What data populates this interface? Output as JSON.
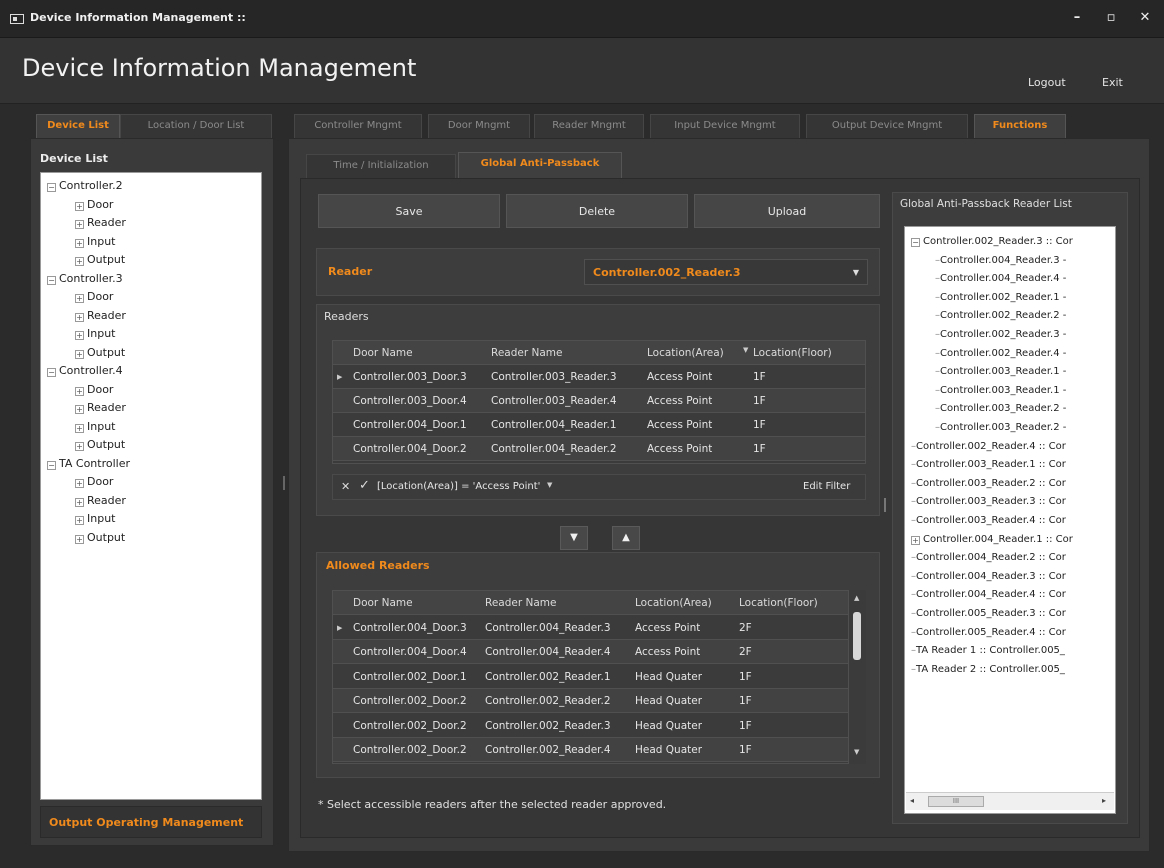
{
  "window": {
    "title": "Device Information Management ::",
    "controls": [
      "minimize-icon",
      "maximize-icon",
      "close-icon"
    ]
  },
  "header": {
    "title": "Device Information Management",
    "logout": "Logout",
    "exit": "Exit"
  },
  "left": {
    "tabs": [
      "Device List",
      "Location / Door List"
    ],
    "list_title": "Device List",
    "tree": [
      {
        "label": "Controller.2",
        "children": [
          "Door",
          "Reader",
          "Input",
          "Output"
        ]
      },
      {
        "label": "Controller.3",
        "children": [
          "Door",
          "Reader",
          "Input",
          "Output"
        ]
      },
      {
        "label": "Controller.4",
        "children": [
          "Door",
          "Reader",
          "Input",
          "Output"
        ]
      },
      {
        "label": "TA Controller",
        "children": [
          "Door",
          "Reader",
          "Input",
          "Output"
        ]
      }
    ],
    "bottom_button": "Output Operating Management"
  },
  "main_tabs": [
    "Controller Mngmt",
    "Door Mngmt",
    "Reader Mngmt",
    "Input Device Mngmt",
    "Output Device Mngmt",
    "Functions"
  ],
  "sub_tabs": [
    "Time / Initialization",
    "Global Anti-Passback"
  ],
  "actions": {
    "save": "Save",
    "delete": "Delete",
    "upload": "Upload"
  },
  "reader": {
    "label": "Reader",
    "value": "Controller.002_Reader.3"
  },
  "readers": {
    "title": "Readers",
    "columns": [
      "Door Name",
      "Reader Name",
      "Location(Area)",
      "Location(Floor)"
    ],
    "rows": [
      [
        "Controller.003_Door.3",
        "Controller.003_Reader.3",
        "Access Point",
        "1F"
      ],
      [
        "Controller.003_Door.4",
        "Controller.003_Reader.4",
        "Access Point",
        "1F"
      ],
      [
        "Controller.004_Door.1",
        "Controller.004_Reader.1",
        "Access Point",
        "1F"
      ],
      [
        "Controller.004_Door.2",
        "Controller.004_Reader.2",
        "Access Point",
        "1F"
      ]
    ],
    "filter_text": "[Location(Area)] = 'Access Point'",
    "edit_filter": "Edit Filter"
  },
  "allowed": {
    "title": "Allowed Readers",
    "columns": [
      "Door Name",
      "Reader Name",
      "Location(Area)",
      "Location(Floor)"
    ],
    "rows": [
      [
        "Controller.004_Door.3",
        "Controller.004_Reader.3",
        "Access Point",
        "2F"
      ],
      [
        "Controller.004_Door.4",
        "Controller.004_Reader.4",
        "Access Point",
        "2F"
      ],
      [
        "Controller.002_Door.1",
        "Controller.002_Reader.1",
        "Head Quater",
        "1F"
      ],
      [
        "Controller.002_Door.2",
        "Controller.002_Reader.2",
        "Head Quater",
        "1F"
      ],
      [
        "Controller.002_Door.2",
        "Controller.002_Reader.3",
        "Head Quater",
        "1F"
      ],
      [
        "Controller.002_Door.2",
        "Controller.002_Reader.4",
        "Head Quater",
        "1F"
      ]
    ]
  },
  "note": "* Select accessible readers after the selected reader approved.",
  "gapb": {
    "title": "Global Anti-Passback Reader List",
    "root": "Controller.002_Reader.3 :: Cor",
    "children": [
      "Controller.004_Reader.3 -",
      "Controller.004_Reader.4 -",
      "Controller.002_Reader.1 -",
      "Controller.002_Reader.2 -",
      "Controller.002_Reader.3 -",
      "Controller.002_Reader.4 -",
      "Controller.003_Reader.1 -",
      "Controller.003_Reader.1 -",
      "Controller.003_Reader.2 -",
      "Controller.003_Reader.2 -"
    ],
    "items": [
      "Controller.002_Reader.4 :: Cor",
      "Controller.003_Reader.1 :: Cor",
      "Controller.003_Reader.2 :: Cor",
      "Controller.003_Reader.3 :: Cor",
      "Controller.003_Reader.4 :: Cor",
      "Controller.004_Reader.1 :: Cor",
      "Controller.004_Reader.2 :: Cor",
      "Controller.004_Reader.3 :: Cor",
      "Controller.004_Reader.4 :: Cor",
      "Controller.005_Reader.3 :: Cor",
      "Controller.005_Reader.4 :: Cor",
      "TA Reader 1 :: Controller.005_",
      "TA Reader 2 :: Controller.005_"
    ],
    "scroll_grip": "III"
  },
  "colors": {
    "accent": "#f08a1c",
    "bg": "#2b2b2b",
    "panel": "#3a3a3a"
  }
}
